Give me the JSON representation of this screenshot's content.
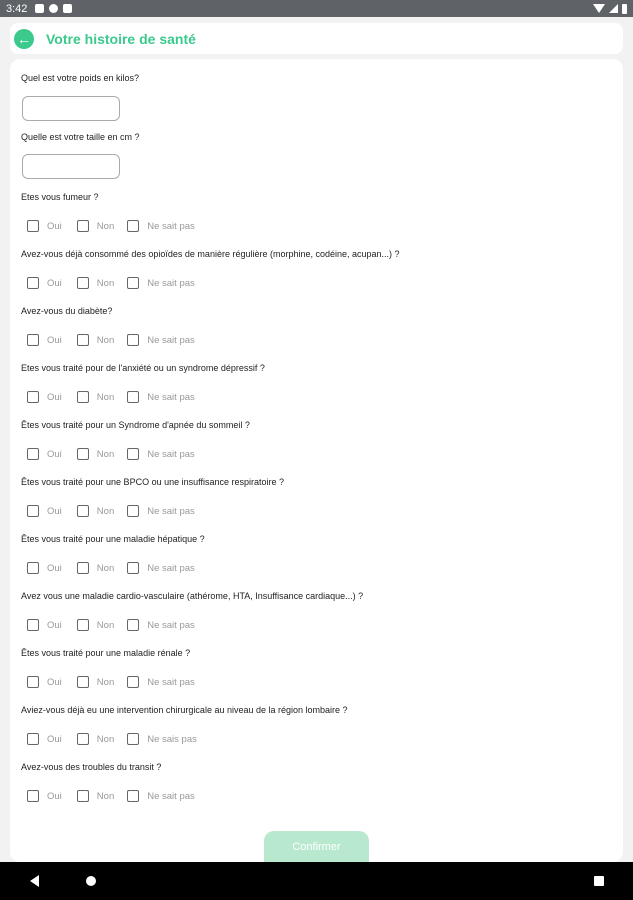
{
  "status_bar": {
    "time": "3:42"
  },
  "header": {
    "title": "Votre histoire de santé"
  },
  "form": {
    "weight_label": "Quel est votre poids en kilos?",
    "weight_value": "",
    "height_label": "Quelle est votre taille en cm ?",
    "height_value": "",
    "questions": [
      {
        "label": "Etes vous fumeur ?",
        "options": [
          "Oui",
          "Non",
          "Ne sait pas"
        ]
      },
      {
        "label": "Avez-vous déjà consommé des opioïdes  de manière régulière (morphine, codéine, acupan...) ?",
        "options": [
          "Oui",
          "Non",
          "Ne sait pas"
        ]
      },
      {
        "label": "Avez-vous du diabète?",
        "options": [
          "Oui",
          "Non",
          "Ne sait pas"
        ]
      },
      {
        "label": "Etes vous traité pour  de l'anxiété ou un syndrome dépressif ?",
        "options": [
          "Oui",
          "Non",
          "Ne sait pas"
        ]
      },
      {
        "label": "Êtes vous traité pour un Syndrome d'apnée du sommeil ?",
        "options": [
          "Oui",
          "Non",
          "Ne sait pas"
        ]
      },
      {
        "label": "Êtes vous traité pour une BPCO ou une insuffisance respiratoire ?",
        "options": [
          "Oui",
          "Non",
          "Ne sait pas"
        ]
      },
      {
        "label": "Êtes vous traité pour une maladie hépatique ?",
        "options": [
          "Oui",
          "Non",
          "Ne sait pas"
        ]
      },
      {
        "label": "Avez vous une maladie cardio-vasculaire (athérome, HTA, Insuffisance cardiaque...) ?",
        "options": [
          "Oui",
          "Non",
          "Ne sait pas"
        ]
      },
      {
        "label": "Êtes vous traité pour une maladie rénale ?",
        "options": [
          "Oui",
          "Non",
          "Ne sait pas"
        ]
      },
      {
        "label": "Aviez-vous déjà eu une intervention chirurgicale au niveau de la région lombaire ?",
        "options": [
          "Oui",
          "Non",
          "Ne sais pas"
        ]
      },
      {
        "label": "Avez-vous des troubles du transit ?",
        "options": [
          "Oui",
          "Non",
          "Ne sait pas"
        ]
      }
    ],
    "confirm_label": "Confirmer"
  },
  "colors": {
    "accent": "#3bc98c",
    "confirm_disabled": "#b8e9cf"
  }
}
